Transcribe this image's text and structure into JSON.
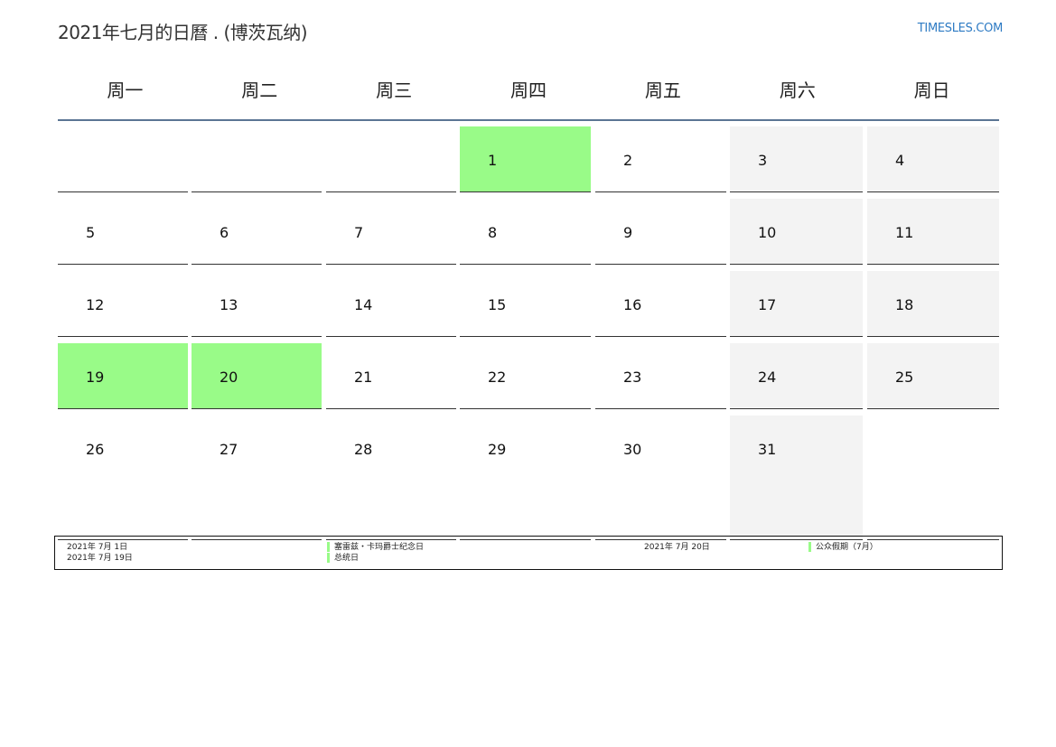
{
  "header": {
    "title": "2021年七月的日曆 . (博茨瓦纳)",
    "brand": "TIMESLES.COM"
  },
  "weekdays": [
    "周一",
    "周二",
    "周三",
    "周四",
    "周五",
    "周六",
    "周日"
  ],
  "calendar": {
    "weeks": [
      [
        "",
        "",
        "",
        "1",
        "2",
        "3",
        "4"
      ],
      [
        "5",
        "6",
        "7",
        "8",
        "9",
        "10",
        "11"
      ],
      [
        "12",
        "13",
        "14",
        "15",
        "16",
        "17",
        "18"
      ],
      [
        "19",
        "20",
        "21",
        "22",
        "23",
        "24",
        "25"
      ],
      [
        "26",
        "27",
        "28",
        "29",
        "30",
        "31",
        ""
      ]
    ],
    "holiday_days": [
      "1",
      "19",
      "20"
    ],
    "holiday_color": "#99fb88",
    "weekend_color": "#f3f3f3"
  },
  "legend": {
    "date1": "2021年 7月 1日",
    "event1": "塞雷兹・卡玛爵士纪念日",
    "date2": "2021年 7月 19日",
    "event2": "总统日",
    "date3": "2021年 7月 20日",
    "event3": "公众假期（7月）"
  }
}
